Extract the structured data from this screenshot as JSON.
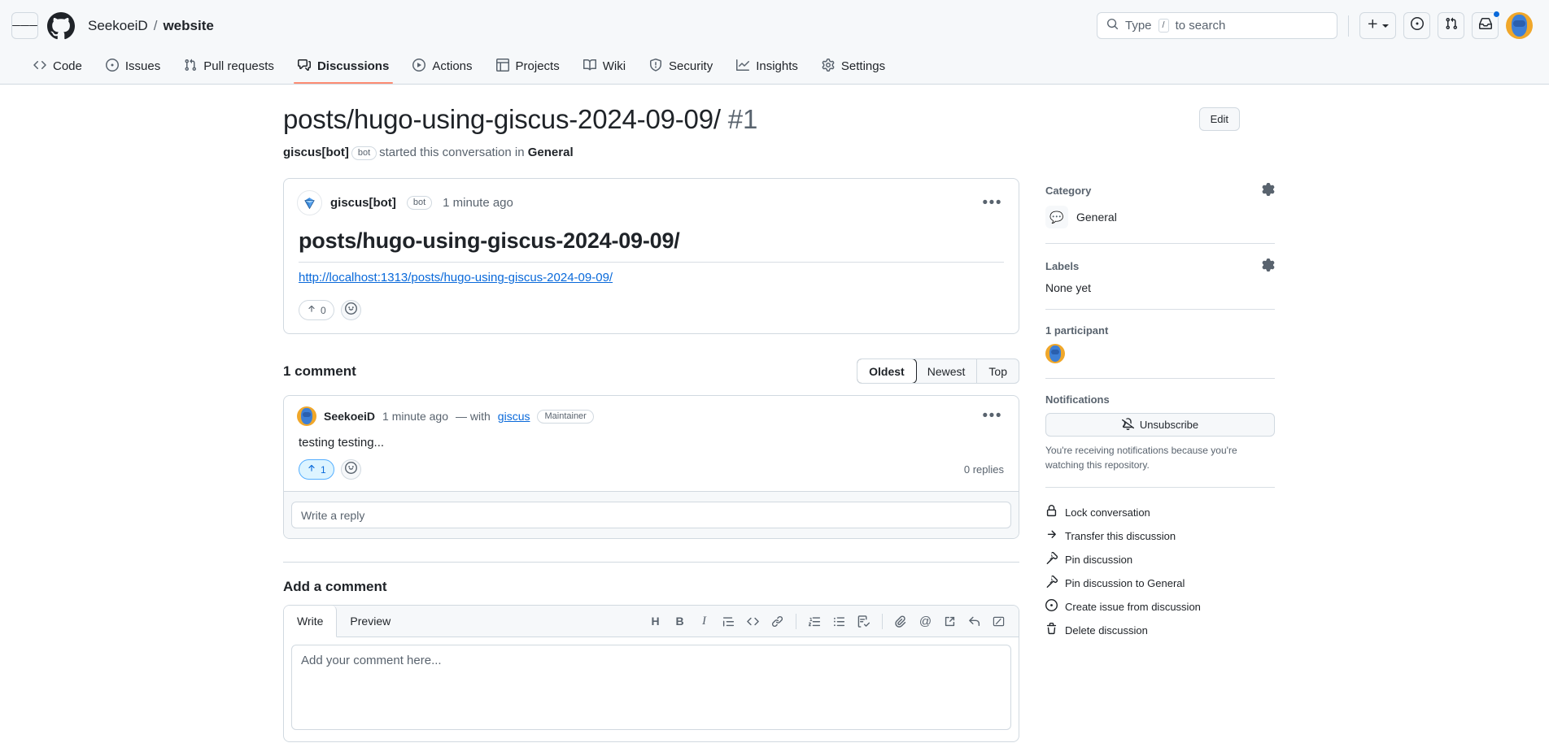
{
  "appbar": {
    "menu_label": "Open global navigation menu",
    "owner": "SeekoeiD",
    "separator": "/",
    "repo": "website",
    "search_placeholder": "Type",
    "search_key": "/",
    "search_suffix": "to search",
    "create_label": "Create new",
    "issues_label": "Your issues",
    "pull_requests_label": "Your pull requests",
    "inbox_label": "Notifications",
    "avatar_label": "Open user account menu"
  },
  "reponav": {
    "items": [
      {
        "label": "Code",
        "icon": "code-icon",
        "active": false
      },
      {
        "label": "Issues",
        "icon": "issue-opened-icon",
        "active": false
      },
      {
        "label": "Pull requests",
        "icon": "git-pull-request-icon",
        "active": false
      },
      {
        "label": "Discussions",
        "icon": "comment-discussion-icon",
        "active": true
      },
      {
        "label": "Actions",
        "icon": "play-icon",
        "active": false
      },
      {
        "label": "Projects",
        "icon": "table-icon",
        "active": false
      },
      {
        "label": "Wiki",
        "icon": "book-icon",
        "active": false
      },
      {
        "label": "Security",
        "icon": "shield-icon",
        "active": false
      },
      {
        "label": "Insights",
        "icon": "graph-icon",
        "active": false
      },
      {
        "label": "Settings",
        "icon": "gear-icon",
        "active": false
      }
    ]
  },
  "discussion": {
    "title": "posts/hugo-using-giscus-2024-09-09/",
    "number": "#1",
    "edit_label": "Edit",
    "subtitle_author": "giscus[bot]",
    "subtitle_bot_badge": "bot",
    "subtitle_middle": "started this conversation in",
    "subtitle_category": "General"
  },
  "post": {
    "author": "giscus[bot]",
    "bot_badge": "bot",
    "timestamp": "1 minute ago",
    "avatar_icon": "gem-icon",
    "menu_icon": "kebab-horizontal-icon",
    "heading": "posts/hugo-using-giscus-2024-09-09/",
    "link_text": "http://localhost:1313/posts/hugo-using-giscus-2024-09-09/",
    "upvote_count": "0",
    "upvote_icon": "arrow-up-icon",
    "emoji_icon": "smiley-icon"
  },
  "comments": {
    "count_label": "1 comment",
    "sort": {
      "options": [
        "Oldest",
        "Newest",
        "Top"
      ],
      "selected": "Oldest"
    },
    "list": [
      {
        "author": "SeekoeiD",
        "timestamp": "1 minute ago",
        "with_prefix": "— with",
        "with_link": "giscus",
        "role": "Maintainer",
        "menu_icon": "kebab-horizontal-icon",
        "body": "testing testing...",
        "upvote_count": "1",
        "upvote_selected": true,
        "replies_label": "0 replies",
        "reply_placeholder": "Write a reply"
      }
    ]
  },
  "add_comment": {
    "title": "Add a comment",
    "tabs": [
      {
        "label": "Write",
        "active": true
      },
      {
        "label": "Preview",
        "active": false
      }
    ],
    "tools": [
      {
        "name": "heading-icon",
        "glyph": "H"
      },
      {
        "name": "bold-icon",
        "glyph": "B"
      },
      {
        "name": "italic-icon",
        "glyph": "I"
      },
      {
        "name": "quote-icon",
        "glyph": ""
      },
      {
        "name": "code-icon",
        "glyph": "<>"
      },
      {
        "name": "link-icon",
        "glyph": ""
      },
      {
        "name": "ordered-list-icon",
        "glyph": ""
      },
      {
        "name": "unordered-list-icon",
        "glyph": ""
      },
      {
        "name": "task-list-icon",
        "glyph": ""
      },
      {
        "name": "attach-file-icon",
        "glyph": ""
      },
      {
        "name": "mention-icon",
        "glyph": "@"
      },
      {
        "name": "saved-reply-icon",
        "glyph": ""
      },
      {
        "name": "reply-icon",
        "glyph": ""
      },
      {
        "name": "markdown-icon",
        "glyph": ""
      }
    ],
    "placeholder": "Add your comment here..."
  },
  "sidebar": {
    "category": {
      "title": "Category",
      "gear_label": "Edit category",
      "emoji": "💬",
      "name": "General"
    },
    "labels": {
      "title": "Labels",
      "gear_label": "Edit labels",
      "value": "None yet"
    },
    "participants": {
      "title": "1 participant",
      "avatars": [
        "SeekoeiD"
      ]
    },
    "notifications": {
      "title": "Notifications",
      "button_label": "Unsubscribe",
      "button_icon": "bell-slash-icon",
      "note": "You're receiving notifications because you're watching this repository."
    },
    "actions": [
      {
        "label": "Lock conversation",
        "icon": "lock-icon"
      },
      {
        "label": "Transfer this discussion",
        "icon": "arrow-right-icon"
      },
      {
        "label": "Pin discussion",
        "icon": "pin-icon"
      },
      {
        "label": "Pin discussion to General",
        "icon": "pin-icon"
      },
      {
        "label": "Create issue from discussion",
        "icon": "issue-opened-icon"
      },
      {
        "label": "Delete discussion",
        "icon": "trash-icon"
      }
    ]
  },
  "colors": {
    "accent": "#0969da",
    "active_tab_underline": "#fd8c73",
    "border": "#d1d9e0",
    "canvas_subtle": "#f6f8fa",
    "text_muted": "#59636e"
  }
}
